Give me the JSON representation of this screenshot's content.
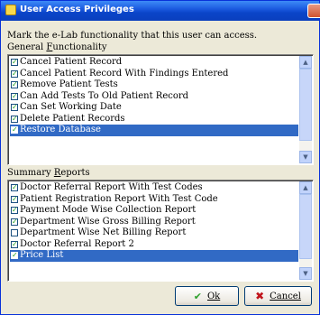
{
  "window": {
    "title": "User Access Privileges"
  },
  "instruction": "Mark the e-Lab functionality that this user can access.",
  "general": {
    "label": "General Functionality",
    "label_underline": "F",
    "items": [
      {
        "label": "Cancel Patient Record",
        "checked": true,
        "selected": false
      },
      {
        "label": "Cancel Patient Record With Findings Entered",
        "checked": true,
        "selected": false
      },
      {
        "label": "Remove Patient Tests",
        "checked": true,
        "selected": false
      },
      {
        "label": "Can Add Tests To Old Patient Record",
        "checked": true,
        "selected": false
      },
      {
        "label": "Can Set Working Date",
        "checked": true,
        "selected": false
      },
      {
        "label": "Delete Patient Records",
        "checked": true,
        "selected": false
      },
      {
        "label": "Restore Database",
        "checked": true,
        "selected": true
      }
    ]
  },
  "summary": {
    "label": "Summary Reports",
    "label_underline": "R",
    "items": [
      {
        "label": "Doctor Referral Report With Test Codes",
        "checked": true,
        "selected": false
      },
      {
        "label": "Patient Registration Report With Test Code",
        "checked": true,
        "selected": false
      },
      {
        "label": "Payment Mode Wise Collection Report",
        "checked": true,
        "selected": false
      },
      {
        "label": "Department Wise Gross Billing Report",
        "checked": true,
        "selected": false
      },
      {
        "label": "Department Wise Net Billing Report",
        "checked": false,
        "selected": false
      },
      {
        "label": "Doctor Referral Report 2",
        "checked": true,
        "selected": false
      },
      {
        "label": "Price List",
        "checked": true,
        "selected": true
      }
    ]
  },
  "buttons": {
    "ok": "Ok",
    "cancel": "Cancel"
  },
  "colors": {
    "selection": "#316ac5",
    "titlebar": "#0a45c9",
    "check": "#21a121",
    "dialog_bg": "#ece9d8"
  }
}
